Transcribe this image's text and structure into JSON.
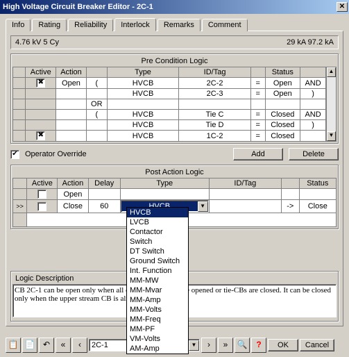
{
  "window": {
    "title": "High Voltage Circuit Breaker Editor - 2C-1"
  },
  "tabs": [
    "Info",
    "Rating",
    "Reliability",
    "Interlock",
    "Remarks",
    "Comment"
  ],
  "active_tab": "Interlock",
  "info": {
    "left": "4.76 kV  5 Cy",
    "right": "29 kA   97.2 kA"
  },
  "pre": {
    "title": "Pre Condition Logic",
    "cols": [
      "Active",
      "Action",
      "",
      "Type",
      "ID/Tag",
      "",
      "Status",
      ""
    ],
    "rows": [
      {
        "active": "✖",
        "action": "Open",
        "p": "(",
        "type": "HVCB",
        "id": "2C-2",
        "eq": "=",
        "status": "Open",
        "op": "AND"
      },
      {
        "active": "",
        "action": "",
        "p": "",
        "type": "HVCB",
        "id": "2C-3",
        "eq": "=",
        "status": "Open",
        "op": ")"
      },
      {
        "active": "",
        "action": "",
        "p": "OR",
        "type": "",
        "id": "",
        "eq": "",
        "status": "",
        "op": ""
      },
      {
        "active": "",
        "action": "",
        "p": "(",
        "type": "HVCB",
        "id": "Tie C",
        "eq": "=",
        "status": "Closed",
        "op": "AND"
      },
      {
        "active": "",
        "action": "",
        "p": "",
        "type": "HVCB",
        "id": "Tie D",
        "eq": "=",
        "status": "Closed",
        "op": ")"
      },
      {
        "active": "✖",
        "action": "",
        "p": "",
        "type": "HVCB",
        "id": "1C-2",
        "eq": "=",
        "status": "Closed",
        "op": ""
      }
    ]
  },
  "override": {
    "checked": true,
    "label": "Operator Override"
  },
  "buttons": {
    "add": "Add",
    "delete": "Delete",
    "ok": "OK",
    "cancel": "Cancel",
    "help": "?"
  },
  "post": {
    "title": "Post Action Logic",
    "cols": [
      "Active",
      "Action",
      "Delay",
      "Type",
      "ID/Tag",
      "",
      "Status"
    ],
    "rows": [
      {
        "active": "☐",
        "action": "Open",
        "delay": "",
        "type": "",
        "id": "",
        "arr": "",
        "status": ""
      },
      {
        "active": "☐",
        "action": "Close",
        "delay": "60",
        "type": "HVCB",
        "id": "",
        "arr": "->",
        "status": "Close"
      }
    ]
  },
  "dropdown": {
    "selected": "HVCB",
    "options": [
      "HVCB",
      "LVCB",
      "Contactor",
      "Switch",
      "DT Switch",
      "Ground Switch",
      "Int. Function",
      "MM-MW",
      "MM-Mvar",
      "MM-Amp",
      "MM-Volts",
      "MM-Freq",
      "MM-PF",
      "VM-Volts",
      "AM-Amp"
    ]
  },
  "desc": {
    "label": "Logic Description",
    "text": "CB 2C-1 can be open only when all down cream CBs are opened or tie-CBs are closed. It can be closed only when the upper stream CB is already closed."
  },
  "nav": {
    "id": "2C-1"
  },
  "chart_data": null
}
